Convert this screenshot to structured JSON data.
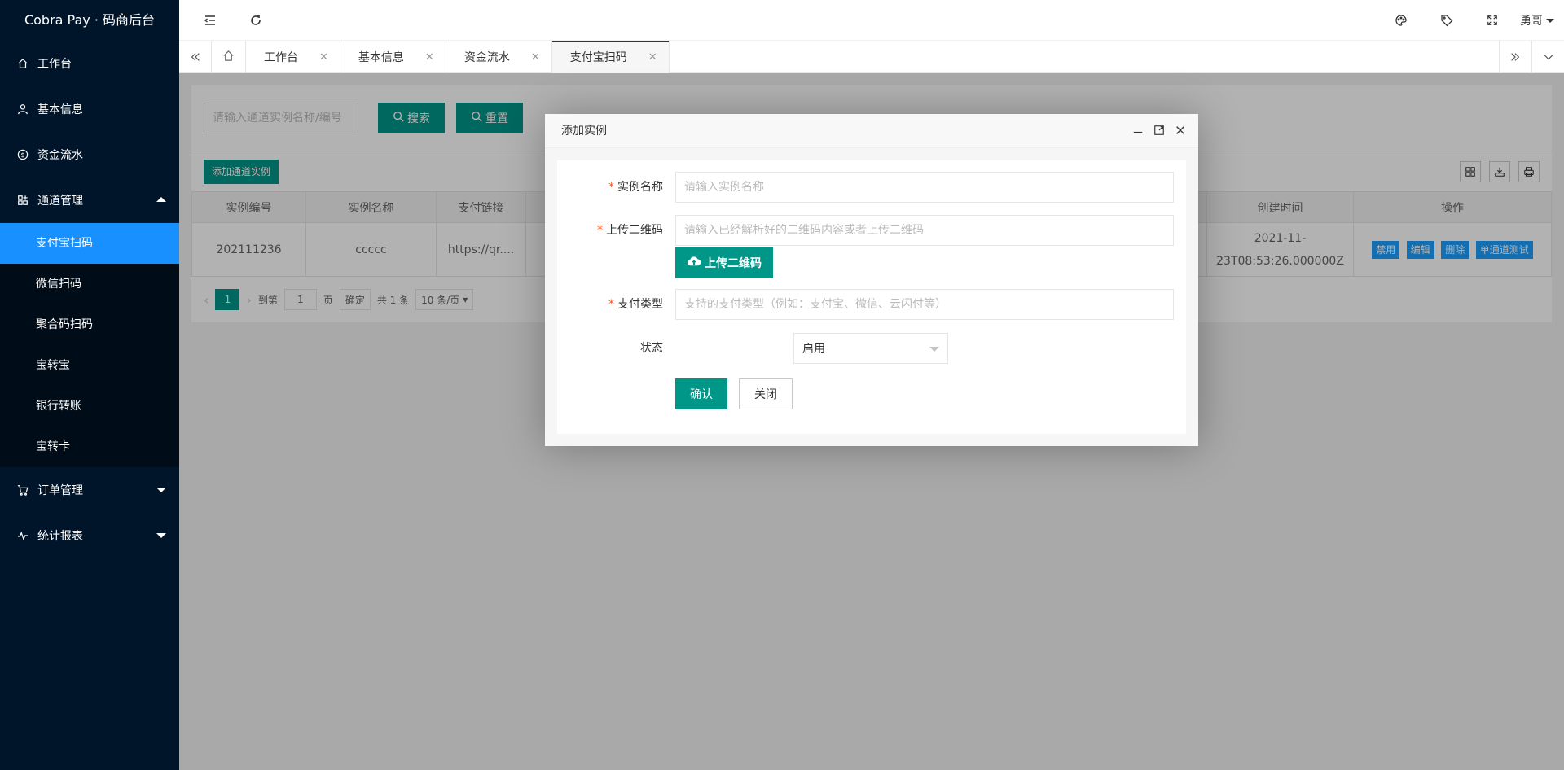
{
  "app": {
    "title": "Cobra Pay · 码商后台",
    "user_name": "勇哥"
  },
  "sidebar": {
    "items": [
      {
        "label": "工作台",
        "icon": "home-icon"
      },
      {
        "label": "基本信息",
        "icon": "user-icon"
      },
      {
        "label": "资金流水",
        "icon": "dollar-icon"
      },
      {
        "label": "通道管理",
        "icon": "apps-icon",
        "expanded": true,
        "children": [
          "支付宝扫码",
          "微信扫码",
          "聚合码扫码",
          "宝转宝",
          "银行转账",
          "宝转卡"
        ],
        "active_child": "支付宝扫码"
      },
      {
        "label": "订单管理",
        "icon": "cart-icon"
      },
      {
        "label": "统计报表",
        "icon": "chart-line-icon"
      }
    ]
  },
  "tabs": {
    "items": [
      "工作台",
      "基本信息",
      "资金流水",
      "支付宝扫码"
    ],
    "active": "支付宝扫码"
  },
  "search": {
    "placeholder": "请输入通道实例名称/编号",
    "search_label": "搜索",
    "reset_label": "重置"
  },
  "toolbar": {
    "add_label": "添加通道实例"
  },
  "table": {
    "columns": [
      "实例编号",
      "实例名称",
      "支付链接",
      "创建时间",
      "操作"
    ],
    "rows": [
      {
        "id": "202111236",
        "name": "ccccc",
        "link": "https://qr....",
        "created_line1": "2021-11-",
        "created_line2": "23T08:53:26.000000Z",
        "actions": [
          "禁用",
          "编辑",
          "删除",
          "单通道测试"
        ]
      }
    ]
  },
  "pager": {
    "current": "1",
    "goto_label": "到第",
    "goto_value": "1",
    "page_label": "页",
    "confirm_label": "确定",
    "total": "共 1 条",
    "per_page": "10 条/页"
  },
  "dialog": {
    "title": "添加实例",
    "name_label": "实例名称",
    "name_placeholder": "请输入实例名称",
    "qr_label": "上传二维码",
    "qr_placeholder": "请输入已经解析好的二维码内容或者上传二维码",
    "qr_upload_label": "上传二维码",
    "pay_type_label": "支付类型",
    "pay_type_placeholder": "支持的支付类型（例如：支付宝、微信、云闪付等）",
    "status_label": "状态",
    "status_value": "启用",
    "confirm_label": "确认",
    "close_label": "关闭"
  },
  "colors": {
    "sidebar_bg": "#001529",
    "active_menu": "#1890ff",
    "primary": "#009688",
    "action_blue": "#1e9fff",
    "required": "#ff5722"
  }
}
